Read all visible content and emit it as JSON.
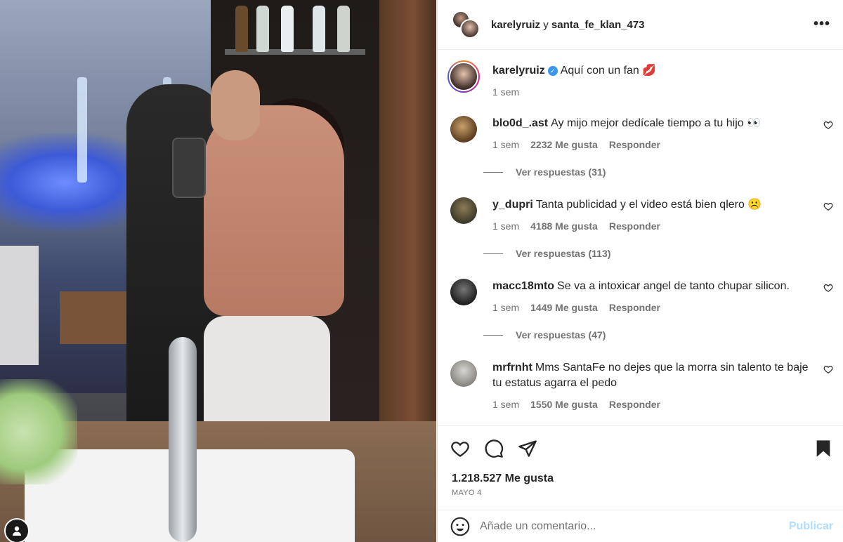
{
  "header": {
    "user1": "karelyruiz",
    "joiner": " y ",
    "user2": "santa_fe_klan_473",
    "more": "•••"
  },
  "caption": {
    "username": "karelyruiz",
    "verified": true,
    "text": "Aquí con un fan 💋",
    "time": "1 sem"
  },
  "comments": [
    {
      "username": "blo0d_.ast",
      "text": "Ay mijo mejor dedícale tiempo a tu hijo 👀",
      "time": "1 sem",
      "likes": "2232 Me gusta",
      "reply": "Responder",
      "view_replies": "Ver respuestas (31)"
    },
    {
      "username": "y_dupri",
      "text": "Tanta publicidad y el video está bien qlero ☹️",
      "time": "1 sem",
      "likes": "4188 Me gusta",
      "reply": "Responder",
      "view_replies": "Ver respuestas (113)"
    },
    {
      "username": "macc18mto",
      "text": "Se va a intoxicar angel de tanto chupar silicon.",
      "time": "1 sem",
      "likes": "1449 Me gusta",
      "reply": "Responder",
      "view_replies": "Ver respuestas (47)"
    },
    {
      "username": "mrfrnht",
      "text": "Mms SantaFe no dejes que la morra sin talento te baje tu estatus agarra el pedo",
      "time": "1 sem",
      "likes": "1550 Me gusta",
      "reply": "Responder"
    }
  ],
  "post": {
    "likes": "1.218.527 Me gusta",
    "date": "MAYO 4"
  },
  "composer": {
    "placeholder": "Añade un comentario...",
    "publish": "Publicar"
  },
  "icons": [
    "heart-icon",
    "comment-icon",
    "share-icon",
    "bookmark-icon",
    "emoji-icon",
    "more-icon",
    "verified-icon"
  ],
  "colors": {
    "verified": "#3897f0",
    "publish_disabled": "#b3dbff",
    "muted_text": "#737373"
  }
}
